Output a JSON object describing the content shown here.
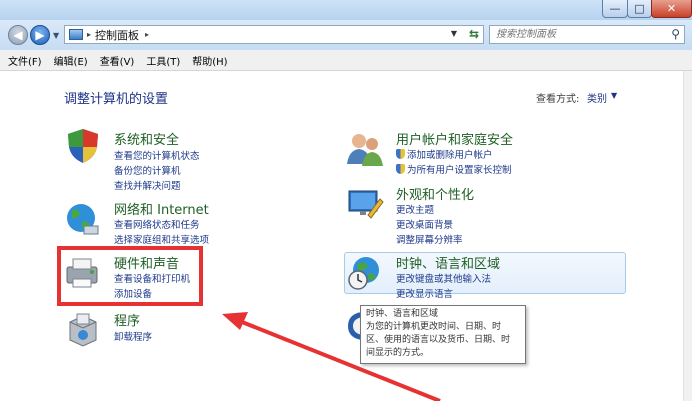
{
  "window": {
    "buttons": {
      "minimize": "—",
      "maximize": "□",
      "close": "✕"
    }
  },
  "nav": {
    "address": "控制面板",
    "separator": "▸",
    "search_placeholder": "搜索控制面板"
  },
  "menu": [
    "文件(F)",
    "编辑(E)",
    "查看(V)",
    "工具(T)",
    "帮助(H)"
  ],
  "content": {
    "title": "调整计算机的设置",
    "view_label": "查看方式:",
    "view_value": "类别"
  },
  "categories": {
    "system": {
      "title": "系统和安全",
      "links": [
        "查看您的计算机状态",
        "备份您的计算机",
        "查找并解决问题"
      ]
    },
    "network": {
      "title": "网络和 Internet",
      "links": [
        "查看网络状态和任务",
        "选择家庭组和共享选项"
      ]
    },
    "hardware": {
      "title": "硬件和声音",
      "links": [
        "查看设备和打印机",
        "添加设备"
      ]
    },
    "programs": {
      "title": "程序",
      "links": [
        "卸载程序"
      ]
    },
    "accounts": {
      "title": "用户帐户和家庭安全",
      "links": [
        "添加或删除用户帐户",
        "为所有用户设置家长控制"
      ]
    },
    "appearance": {
      "title": "外观和个性化",
      "links": [
        "更改主题",
        "更改桌面背景",
        "调整屏幕分辨率"
      ]
    },
    "clock": {
      "title": "时钟、语言和区域",
      "links": [
        "更改键盘或其他输入法",
        "更改显示语言"
      ]
    }
  },
  "tooltip": {
    "title": "时钟、语言和区域",
    "line1": "为您的计算机更改时间、日期、时",
    "line2": "区、使用的语言以及货币、日期、时",
    "line3": "间显示的方式。"
  },
  "colors": {
    "link": "#1e3a8a",
    "category_title": "#1e5f24",
    "highlight_red": "#e63232"
  }
}
